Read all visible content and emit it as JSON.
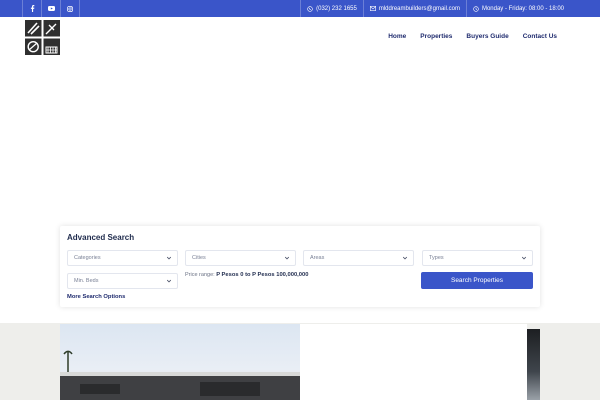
{
  "topbar": {
    "social": [
      {
        "icon": "facebook-icon"
      },
      {
        "icon": "youtube-icon"
      },
      {
        "icon": "instagram-icon"
      }
    ],
    "phone": "(032) 232 1655",
    "email": "mlddreambuilders@gmail.com",
    "hours": "Monday - Friday: 08:00 - 18:00"
  },
  "nav": {
    "home": "Home",
    "properties": "Properties",
    "buyers_guide": "Buyers Guide",
    "contact": "Contact Us"
  },
  "search": {
    "title": "Advanced Search",
    "categories": "Categories",
    "cities": "Cities",
    "areas": "Areas",
    "types": "Types",
    "min_beds": "Min. Beds",
    "price_label": "Price range:",
    "price_value": "P Pesos 0 to P Pesos 100,000,000",
    "button": "Search Properties",
    "more": "More Search Options"
  },
  "colors": {
    "accent": "#3a55c9",
    "nav_text": "#1f2b6e"
  }
}
